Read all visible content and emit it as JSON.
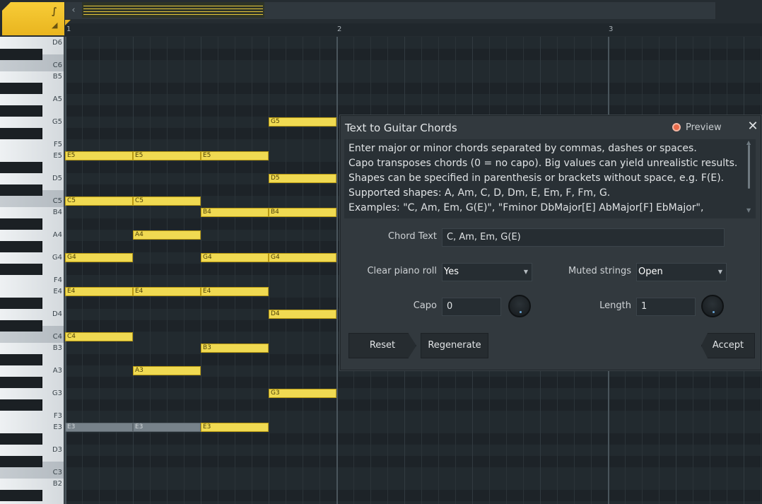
{
  "ruler": {
    "bar_numbers": [
      "1",
      "2",
      "3"
    ]
  },
  "toolbar": {
    "scroll_arrow": "‹",
    "tool_glyph_1": "∫",
    "tool_glyph_2": "◢"
  },
  "piano": {
    "key_labels": [
      "D6",
      "C6",
      "B5",
      "A5",
      "G5",
      "F5",
      "E5",
      "D5",
      "C5",
      "B4",
      "A4",
      "G4",
      "F4",
      "E4",
      "D4",
      "C4",
      "B3",
      "A3",
      "G3",
      "F3",
      "E3",
      "D3",
      "C3",
      "B2"
    ]
  },
  "notes": [
    {
      "label": "G5",
      "row": 4,
      "col": 3
    },
    {
      "label": "E5",
      "row": 6,
      "col": 0
    },
    {
      "label": "E5",
      "row": 6,
      "col": 1
    },
    {
      "label": "E5",
      "row": 6,
      "col": 2
    },
    {
      "label": "D5",
      "row": 7,
      "col": 3
    },
    {
      "label": "C5",
      "row": 8,
      "col": 0
    },
    {
      "label": "C5",
      "row": 8,
      "col": 1
    },
    {
      "label": "B4",
      "row": 9,
      "col": 2
    },
    {
      "label": "B4",
      "row": 9,
      "col": 3
    },
    {
      "label": "A4",
      "row": 10,
      "col": 1
    },
    {
      "label": "G4",
      "row": 11,
      "col": 0
    },
    {
      "label": "G4",
      "row": 11,
      "col": 2
    },
    {
      "label": "G4",
      "row": 11,
      "col": 3
    },
    {
      "label": "E4",
      "row": 13,
      "col": 0
    },
    {
      "label": "E4",
      "row": 13,
      "col": 1
    },
    {
      "label": "E4",
      "row": 13,
      "col": 2
    },
    {
      "label": "D4",
      "row": 14,
      "col": 3
    },
    {
      "label": "C4",
      "row": 15,
      "col": 0
    },
    {
      "label": "B3",
      "row": 16,
      "col": 2
    },
    {
      "label": "A3",
      "row": 17,
      "col": 1
    },
    {
      "label": "G3",
      "row": 18,
      "col": 3
    },
    {
      "label": "E3",
      "row": 20,
      "col": 0,
      "ghost": true
    },
    {
      "label": "E3",
      "row": 20,
      "col": 1,
      "ghost": true
    },
    {
      "label": "E3",
      "row": 20,
      "col": 2
    }
  ],
  "dialog": {
    "title": "Text to Guitar Chords",
    "preview_label": "Preview",
    "close_glyph": "✕",
    "description": [
      "Enter major or minor chords separated by commas, dashes or spaces.",
      "Capo transposes chords (0 = no capo). Big values can yield unrealistic results.",
      "Shapes can be specified in parenthesis or brackets without space, e.g. F(E).",
      "Supported shapes: A, Am, C, D, Dm, E, Em, F, Fm, G.",
      "Examples: \"C, Am, Em, G(E)\", \"Fminor DbMajor[E] AbMajor[F] EbMajor\","
    ],
    "chord_text_label": "Chord Text",
    "chord_text_value": "C, Am, Em, G(E)",
    "clear_piano_roll_label": "Clear piano roll",
    "clear_piano_roll_value": "Yes",
    "muted_strings_label": "Muted strings",
    "muted_strings_value": "Open",
    "capo_label": "Capo",
    "capo_value": "0",
    "length_label": "Length",
    "length_value": "1",
    "reset_label": "Reset",
    "regenerate_label": "Regenerate",
    "accept_label": "Accept"
  }
}
